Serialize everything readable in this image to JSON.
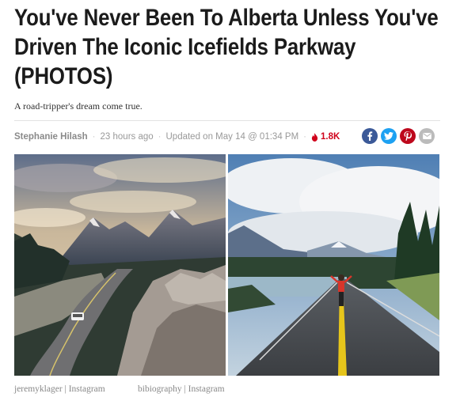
{
  "article": {
    "headline": "You've Never Been To Alberta Unless You've Driven The Iconic Icefields Parkway (PHOTOS)",
    "subhead": "A road-tripper's dream come true.",
    "byline": {
      "author": "Stephanie Hilash",
      "posted": "23 hours ago",
      "updated": "Updated on May 14 @ 01:34 PM",
      "views": "1.8K"
    },
    "share_icons": [
      "facebook-icon",
      "twitter-icon",
      "pinterest-icon",
      "email-icon"
    ],
    "photos": [
      {
        "credit": "jeremyklager | Instagram"
      },
      {
        "credit": "bibiography | Instagram"
      }
    ]
  },
  "colors": {
    "headline": "#1b1b1b",
    "views": "#d0021b",
    "facebook": "#3b5998",
    "twitter": "#1da1f2",
    "pinterest": "#bd081c",
    "email": "#bbbbbb"
  }
}
